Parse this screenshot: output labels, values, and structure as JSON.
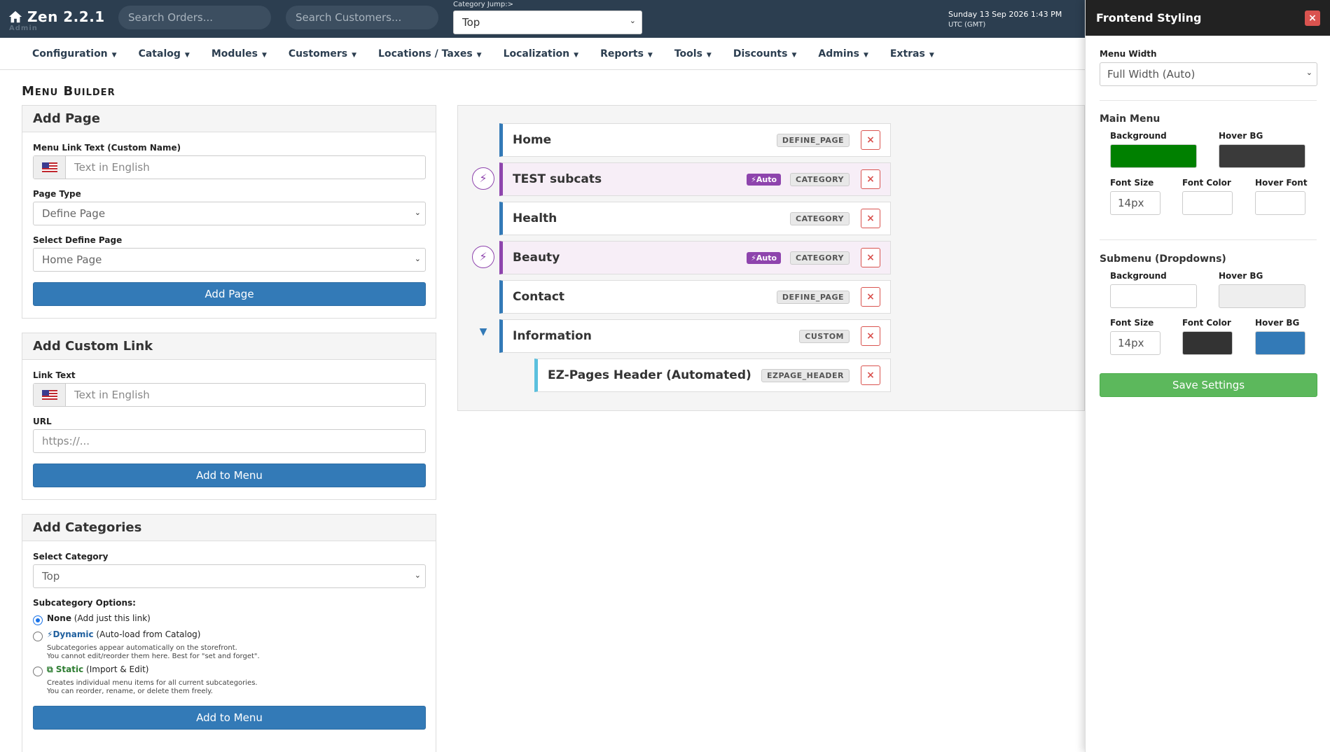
{
  "header": {
    "app_title": "Zen 2.2.1",
    "app_sub": "Admin",
    "search_orders_placeholder": "Search Orders...",
    "search_customers_placeholder": "Search Customers...",
    "category_jump_label": "Category Jump:>",
    "category_jump_value": "Top",
    "date": "Sunday 13 Sep 2026 1:43 PM",
    "timezone": "UTC (GMT)"
  },
  "nav": {
    "items": [
      "Configuration",
      "Catalog",
      "Modules",
      "Customers",
      "Locations / Taxes",
      "Localization",
      "Reports",
      "Tools",
      "Discounts",
      "Admins",
      "Extras"
    ]
  },
  "page": {
    "title": "Menu Builder"
  },
  "add_page": {
    "heading": "Add Page",
    "link_text_label": "Menu Link Text (Custom Name)",
    "link_text_placeholder": "Text in English",
    "page_type_label": "Page Type",
    "page_type_value": "Define Page",
    "define_page_label": "Select Define Page",
    "define_page_value": "Home Page",
    "button": "Add Page"
  },
  "custom_link": {
    "heading": "Add Custom Link",
    "link_text_label": "Link Text",
    "link_text_placeholder": "Text in English",
    "url_label": "URL",
    "url_placeholder": "https://...",
    "button": "Add to Menu"
  },
  "categories": {
    "heading": "Add Categories",
    "select_label": "Select Category",
    "select_value": "Top",
    "options_label": "Subcategory Options:",
    "opt_none_title": "None",
    "opt_none_desc": "(Add just this link)",
    "opt_dynamic_title": "Dynamic",
    "opt_dynamic_desc": "(Auto-load from Catalog)",
    "opt_dynamic_hint1": "Subcategories appear automatically on the storefront.",
    "opt_dynamic_hint2": "You cannot edit/reorder them here. Best for \"set and forget\".",
    "opt_static_title": "Static",
    "opt_static_desc": "(Import & Edit)",
    "opt_static_hint1": "Creates individual menu items for all current subcategories.",
    "opt_static_hint2": "You can reorder, rename, or delete them freely.",
    "button": "Add to Menu"
  },
  "menu_tree": {
    "items": [
      {
        "label": "Home",
        "type": "DEFINE_PAGE"
      },
      {
        "label": "TEST subcats",
        "auto": "Auto",
        "type": "CATEGORY"
      },
      {
        "label": "Health",
        "type": "CATEGORY"
      },
      {
        "label": "Beauty",
        "auto": "Auto",
        "type": "CATEGORY"
      },
      {
        "label": "Contact",
        "type": "DEFINE_PAGE"
      },
      {
        "label": "Information",
        "type": "CUSTOM"
      },
      {
        "label": "EZ-Pages Header (Automated)",
        "type": "EZPAGE_HEADER"
      }
    ],
    "delete_glyph": "×"
  },
  "styling": {
    "title": "Frontend Styling",
    "close_glyph": "×",
    "menu_width_label": "Menu Width",
    "menu_width_value": "Full Width (Auto)",
    "main_menu_heading": "Main Menu",
    "main_bg_label": "Background",
    "main_hover_bg_label": "Hover BG",
    "main_font_size_label": "Font Size",
    "main_font_size_value": "14px",
    "main_font_color_label": "Font Color",
    "main_hover_font_label": "Hover Font",
    "main_bg_color": "#008000",
    "main_hover_bg_color": "#3a3a3a",
    "main_font_color": "#ffffff",
    "main_hover_font_color": "#ffffff",
    "submenu_heading": "Submenu (Dropdowns)",
    "sub_bg_label": "Background",
    "sub_hover_bg_label": "Hover BG",
    "sub_font_size_label": "Font Size",
    "sub_font_size_value": "14px",
    "sub_font_color_label": "Font Color",
    "sub_hover_bg2_label": "Hover BG",
    "sub_bg_color": "#ffffff",
    "sub_hover_bg_color": "#eeeeee",
    "sub_font_color": "#333333",
    "sub_hover_color": "#337ab7",
    "save_button": "Save Settings"
  }
}
